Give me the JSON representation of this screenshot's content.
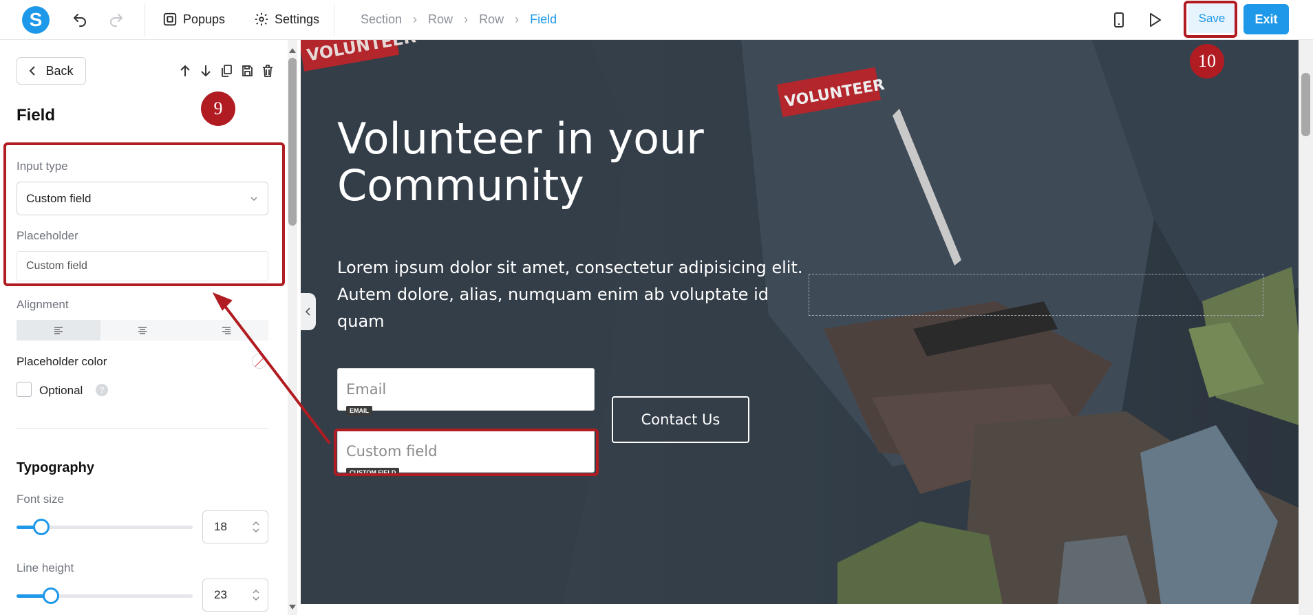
{
  "topbar": {
    "logo_letter": "S",
    "nav": {
      "popups_label": "Popups",
      "settings_label": "Settings"
    },
    "breadcrumb": [
      "Section",
      "Row",
      "Row",
      "Field"
    ],
    "save_label": "Save",
    "exit_label": "Exit"
  },
  "panel": {
    "back_label": "Back",
    "title": "Field",
    "input_type_label": "Input type",
    "input_type_value": "Custom field",
    "placeholder_label": "Placeholder",
    "placeholder_value": "Custom field",
    "alignment_label": "Alignment",
    "alignment_selected": "left",
    "placeholder_color_label": "Placeholder color",
    "optional_label": "Optional",
    "optional_checked": false,
    "help_glyph": "?",
    "typography_label": "Typography",
    "font_size_label": "Font size",
    "font_size_value": "18",
    "line_height_label": "Line height",
    "line_height_value": "23"
  },
  "canvas": {
    "headline": "Volunteer in your Community",
    "body": "Lorem ipsum dolor sit amet, consectetur adipisicing elit. Autem dolore, alias, numquam enim ab voluptate id quam",
    "email_placeholder": "Email",
    "email_tag": "EMAIL",
    "custom_placeholder": "Custom field",
    "custom_tag": "CUSTOM FIELD",
    "contact_label": "Contact Us",
    "shirt_text_1": "VOLUNTEER",
    "shirt_text_2": "VOLUNTEER"
  },
  "annotations": {
    "badge_left": "9",
    "badge_right": "10",
    "color": "#b01c22"
  },
  "colors": {
    "accent": "#1e98e8",
    "annotation": "#b01c22"
  }
}
